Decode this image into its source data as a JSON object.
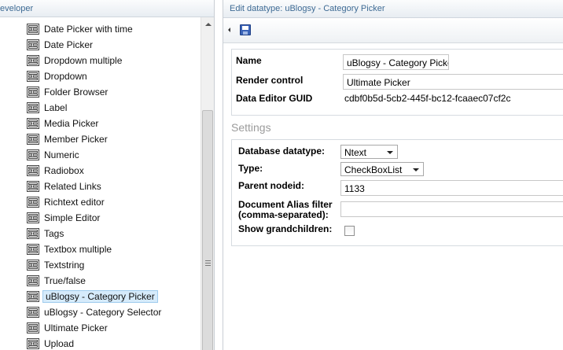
{
  "left_panel": {
    "header": "eveloper",
    "items": [
      {
        "label": "Date Picker with time",
        "selected": false
      },
      {
        "label": "Date Picker",
        "selected": false
      },
      {
        "label": "Dropdown multiple",
        "selected": false
      },
      {
        "label": "Dropdown",
        "selected": false
      },
      {
        "label": "Folder Browser",
        "selected": false
      },
      {
        "label": "Label",
        "selected": false
      },
      {
        "label": "Media Picker",
        "selected": false
      },
      {
        "label": "Member Picker",
        "selected": false
      },
      {
        "label": "Numeric",
        "selected": false
      },
      {
        "label": "Radiobox",
        "selected": false
      },
      {
        "label": "Related Links",
        "selected": false
      },
      {
        "label": "Richtext editor",
        "selected": false
      },
      {
        "label": "Simple Editor",
        "selected": false
      },
      {
        "label": "Tags",
        "selected": false
      },
      {
        "label": "Textbox multiple",
        "selected": false
      },
      {
        "label": "Textstring",
        "selected": false
      },
      {
        "label": "True/false",
        "selected": false
      },
      {
        "label": "uBlogsy - Category Picker",
        "selected": true
      },
      {
        "label": "uBlogsy - Category Selector",
        "selected": false
      },
      {
        "label": "Ultimate Picker",
        "selected": false
      },
      {
        "label": "Upload",
        "selected": false
      }
    ],
    "item_icon": "datatype-icon"
  },
  "right_panel": {
    "header": "Edit datatype: uBlogsy - Category Picker",
    "toolbar": {
      "save_icon": "save-icon",
      "collapse_icon": "collapse-arrow-icon"
    },
    "properties": {
      "name_label": "Name",
      "name_value": "uBlogsy - Category Picker",
      "render_control_label": "Render control",
      "render_control_value": "Ultimate Picker",
      "guid_label": "Data Editor GUID",
      "guid_value": "cdbf0b5d-5cb2-445f-bc12-fcaaec07cf2c"
    },
    "settings_heading": "Settings",
    "settings": {
      "db_type_label": "Database datatype:",
      "db_type_value": "Ntext",
      "type_label": "Type:",
      "type_value": "CheckBoxList",
      "parent_label": "Parent nodeid:",
      "parent_value": "1133",
      "alias_label_line1": "Document Alias filter",
      "alias_label_line2": "(comma-separated):",
      "alias_value": "",
      "grandchildren_label": "Show grandchildren:",
      "grandchildren_checked": false
    }
  }
}
